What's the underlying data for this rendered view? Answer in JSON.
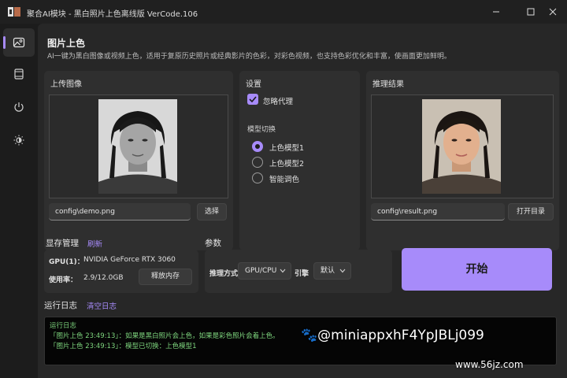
{
  "window": {
    "title": "聚合AI模块 - 黑白照片上色离线版 VerCode.106"
  },
  "sidebar": {
    "items": [
      {
        "icon": "image-icon",
        "active": true
      },
      {
        "icon": "film-icon",
        "active": false
      },
      {
        "icon": "power-icon",
        "active": false
      },
      {
        "icon": "brightness-icon",
        "active": false
      }
    ]
  },
  "page": {
    "title": "图片上色",
    "description": "AI一键为黑白图像或视频上色，适用于复原历史照片或经典影片的色彩，对彩色视频，也支持色彩优化和丰富，使画面更加鲜明。"
  },
  "upload": {
    "title": "上传图像",
    "path": "config\\demo.png",
    "select_label": "选择"
  },
  "settings": {
    "title": "设置",
    "ignore_proxy_label": "忽略代理",
    "ignore_proxy_checked": true,
    "model_switch_label": "模型切换",
    "models": [
      {
        "label": "上色模型1",
        "checked": true
      },
      {
        "label": "上色模型2",
        "checked": false
      },
      {
        "label": "智能调色",
        "checked": false
      }
    ]
  },
  "result": {
    "title": "推理结果",
    "path": "config\\result.png",
    "open_dir_label": "打开目录"
  },
  "memory": {
    "title": "显存管理",
    "refresh_label": "刷新",
    "gpu_label": "GPU(1)：",
    "gpu_value": "NVIDIA GeForce RTX 3060",
    "usage_label": "使用率：",
    "usage_value": "2.9/12.0GB",
    "release_label": "释放内存"
  },
  "params": {
    "title": "参数",
    "inference_label": "推理方式",
    "inference_value": "GPU/CPU",
    "engine_label": "引擎",
    "engine_value": "默认"
  },
  "start": {
    "label": "开始"
  },
  "log": {
    "title": "运行日志",
    "clear_label": "清空日志",
    "lines": [
      "运行日志",
      "「图片上色 23:49:13」：如果是黑白照片会上色，如果是彩色照片会着上色。",
      "「图片上色 23:49:13」：模型已切换：上色模型1"
    ]
  },
  "watermark": {
    "text": "@miniappxhF4YpJBLj099",
    "site": "www.56jz.com"
  },
  "colors": {
    "accent": "#a78bfa",
    "log_text": "#7ed67e"
  }
}
